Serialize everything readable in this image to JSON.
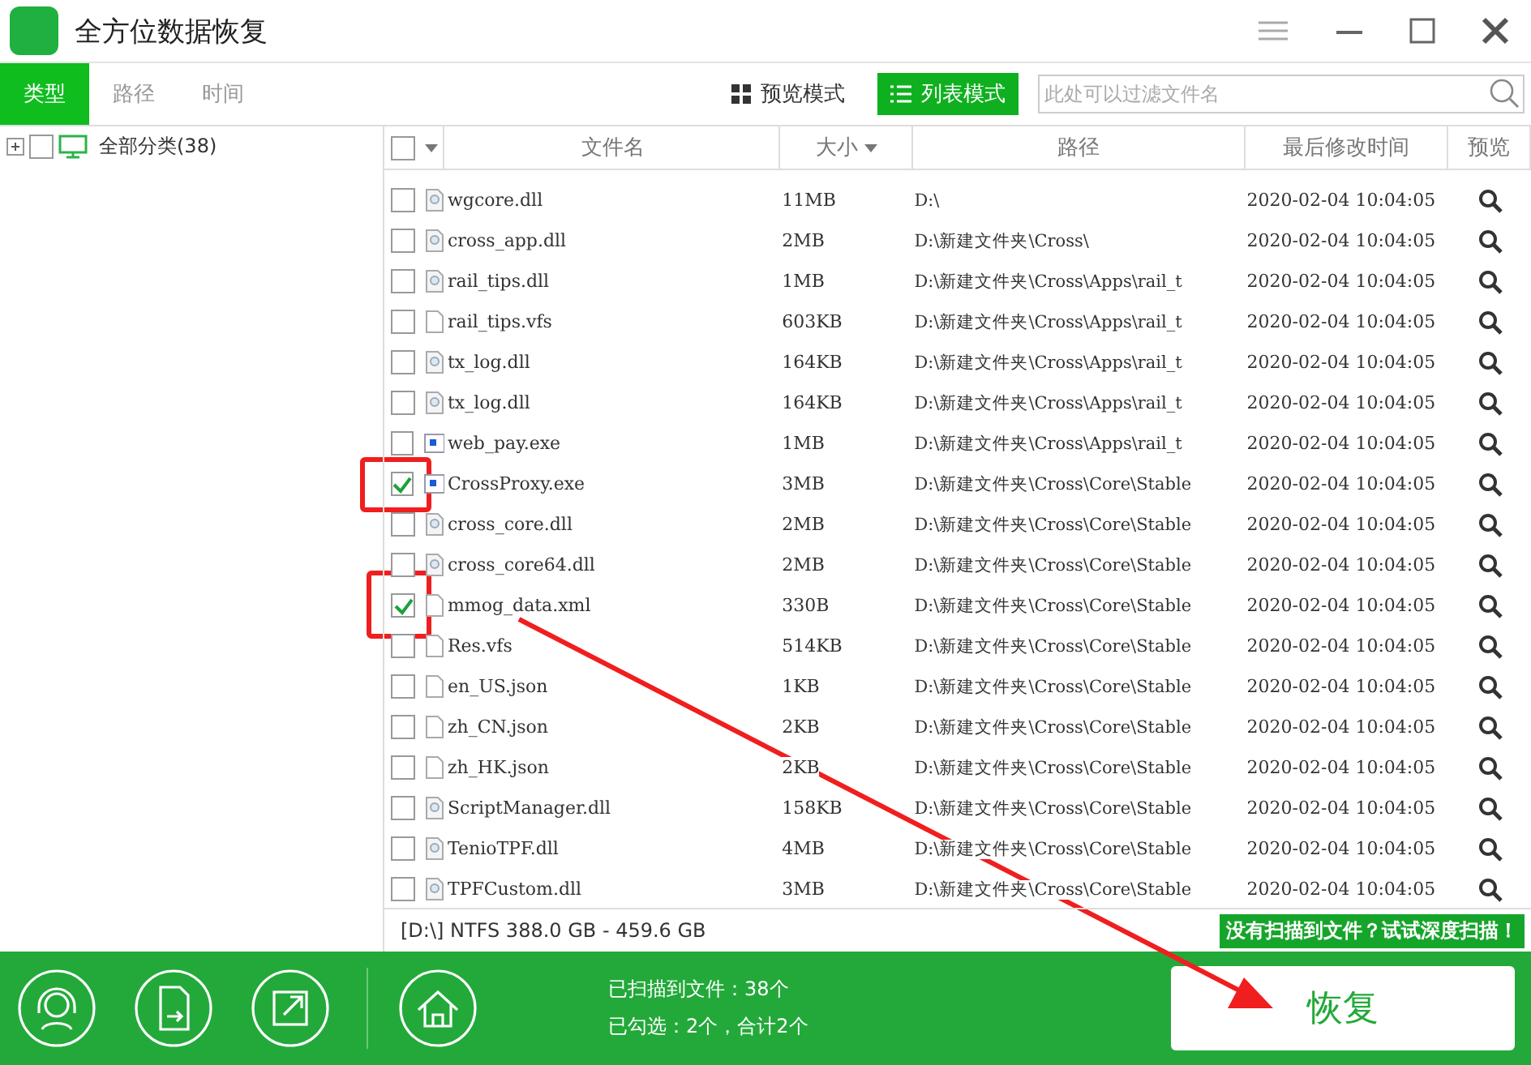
{
  "window": {
    "title": "全方位数据恢复"
  },
  "category_tabs": [
    {
      "label": "类型",
      "selected": true
    },
    {
      "label": "路径",
      "selected": false
    },
    {
      "label": "时间",
      "selected": false
    }
  ],
  "view_modes": [
    {
      "label": "预览模式",
      "selected": false,
      "kind": "grid"
    },
    {
      "label": "列表模式",
      "selected": true,
      "kind": "list"
    }
  ],
  "filter": {
    "placeholder": "此处可以过滤文件名"
  },
  "tree": {
    "label": "全部分类(38)",
    "checked": false,
    "expanded": false
  },
  "table": {
    "select_all_checked": false,
    "columns": [
      "文件名",
      "大小",
      "路径",
      "最后修改时间",
      "预览"
    ],
    "rows": [
      {
        "name": "wgcore.dll",
        "kind": "dll",
        "size": "11MB",
        "path": "D:\\",
        "modified": "2020-02-04  10:04:05",
        "checked": false
      },
      {
        "name": "cross_app.dll",
        "kind": "dll",
        "size": "2MB",
        "path": "D:\\新建文件夹\\Cross\\",
        "modified": "2020-02-04  10:04:05",
        "checked": false
      },
      {
        "name": "rail_tips.dll",
        "kind": "dll",
        "size": "1MB",
        "path": "D:\\新建文件夹\\Cross\\Apps\\rail_t",
        "modified": "2020-02-04  10:04:05",
        "checked": false
      },
      {
        "name": "rail_tips.vfs",
        "kind": "blank",
        "size": "603KB",
        "path": "D:\\新建文件夹\\Cross\\Apps\\rail_t",
        "modified": "2020-02-04  10:04:05",
        "checked": false
      },
      {
        "name": "tx_log.dll",
        "kind": "dll",
        "size": "164KB",
        "path": "D:\\新建文件夹\\Cross\\Apps\\rail_t",
        "modified": "2020-02-04  10:04:05",
        "checked": false
      },
      {
        "name": "tx_log.dll",
        "kind": "dll",
        "size": "164KB",
        "path": "D:\\新建文件夹\\Cross\\Apps\\rail_t",
        "modified": "2020-02-04  10:04:05",
        "checked": false
      },
      {
        "name": "web_pay.exe",
        "kind": "exe",
        "size": "1MB",
        "path": "D:\\新建文件夹\\Cross\\Apps\\rail_t",
        "modified": "2020-02-04  10:04:05",
        "checked": false
      },
      {
        "name": "CrossProxy.exe",
        "kind": "exe",
        "size": "3MB",
        "path": "D:\\新建文件夹\\Cross\\Core\\Stable",
        "modified": "2020-02-04  10:04:05",
        "checked": true
      },
      {
        "name": "cross_core.dll",
        "kind": "dll",
        "size": "2MB",
        "path": "D:\\新建文件夹\\Cross\\Core\\Stable",
        "modified": "2020-02-04  10:04:05",
        "checked": false
      },
      {
        "name": "cross_core64.dll",
        "kind": "dll",
        "size": "2MB",
        "path": "D:\\新建文件夹\\Cross\\Core\\Stable",
        "modified": "2020-02-04  10:04:05",
        "checked": false
      },
      {
        "name": "mmog_data.xml",
        "kind": "blank",
        "size": "330B",
        "path": "D:\\新建文件夹\\Cross\\Core\\Stable",
        "modified": "2020-02-04  10:04:05",
        "checked": true
      },
      {
        "name": "Res.vfs",
        "kind": "blank",
        "size": "514KB",
        "path": "D:\\新建文件夹\\Cross\\Core\\Stable",
        "modified": "2020-02-04  10:04:05",
        "checked": false
      },
      {
        "name": "en_US.json",
        "kind": "blank",
        "size": "1KB",
        "path": "D:\\新建文件夹\\Cross\\Core\\Stable",
        "modified": "2020-02-04  10:04:05",
        "checked": false
      },
      {
        "name": "zh_CN.json",
        "kind": "blank",
        "size": "2KB",
        "path": "D:\\新建文件夹\\Cross\\Core\\Stable",
        "modified": "2020-02-04  10:04:05",
        "checked": false
      },
      {
        "name": "zh_HK.json",
        "kind": "blank",
        "size": "2KB",
        "path": "D:\\新建文件夹\\Cross\\Core\\Stable",
        "modified": "2020-02-04  10:04:05",
        "checked": false
      },
      {
        "name": "ScriptManager.dll",
        "kind": "dll",
        "size": "158KB",
        "path": "D:\\新建文件夹\\Cross\\Core\\Stable",
        "modified": "2020-02-04  10:04:05",
        "checked": false
      },
      {
        "name": "TenioTPF.dll",
        "kind": "dll",
        "size": "4MB",
        "path": "D:\\新建文件夹\\Cross\\Core\\Stable",
        "modified": "2020-02-04  10:04:05",
        "checked": false
      },
      {
        "name": "TPFCustom.dll",
        "kind": "dll",
        "size": "3MB",
        "path": "D:\\新建文件夹\\Cross\\Core\\Stable",
        "modified": "2020-02-04  10:04:05",
        "checked": false
      }
    ]
  },
  "status_bar": {
    "drive": "[D:\\] NTFS 388.0 GB - 459.6 GB",
    "deep_scan": "没有扫描到文件？试试深度扫描！"
  },
  "footer": {
    "scanned": "已扫描到文件：38个",
    "selected": "已勾选：2个，合计2个",
    "recover_button": "恢复"
  }
}
